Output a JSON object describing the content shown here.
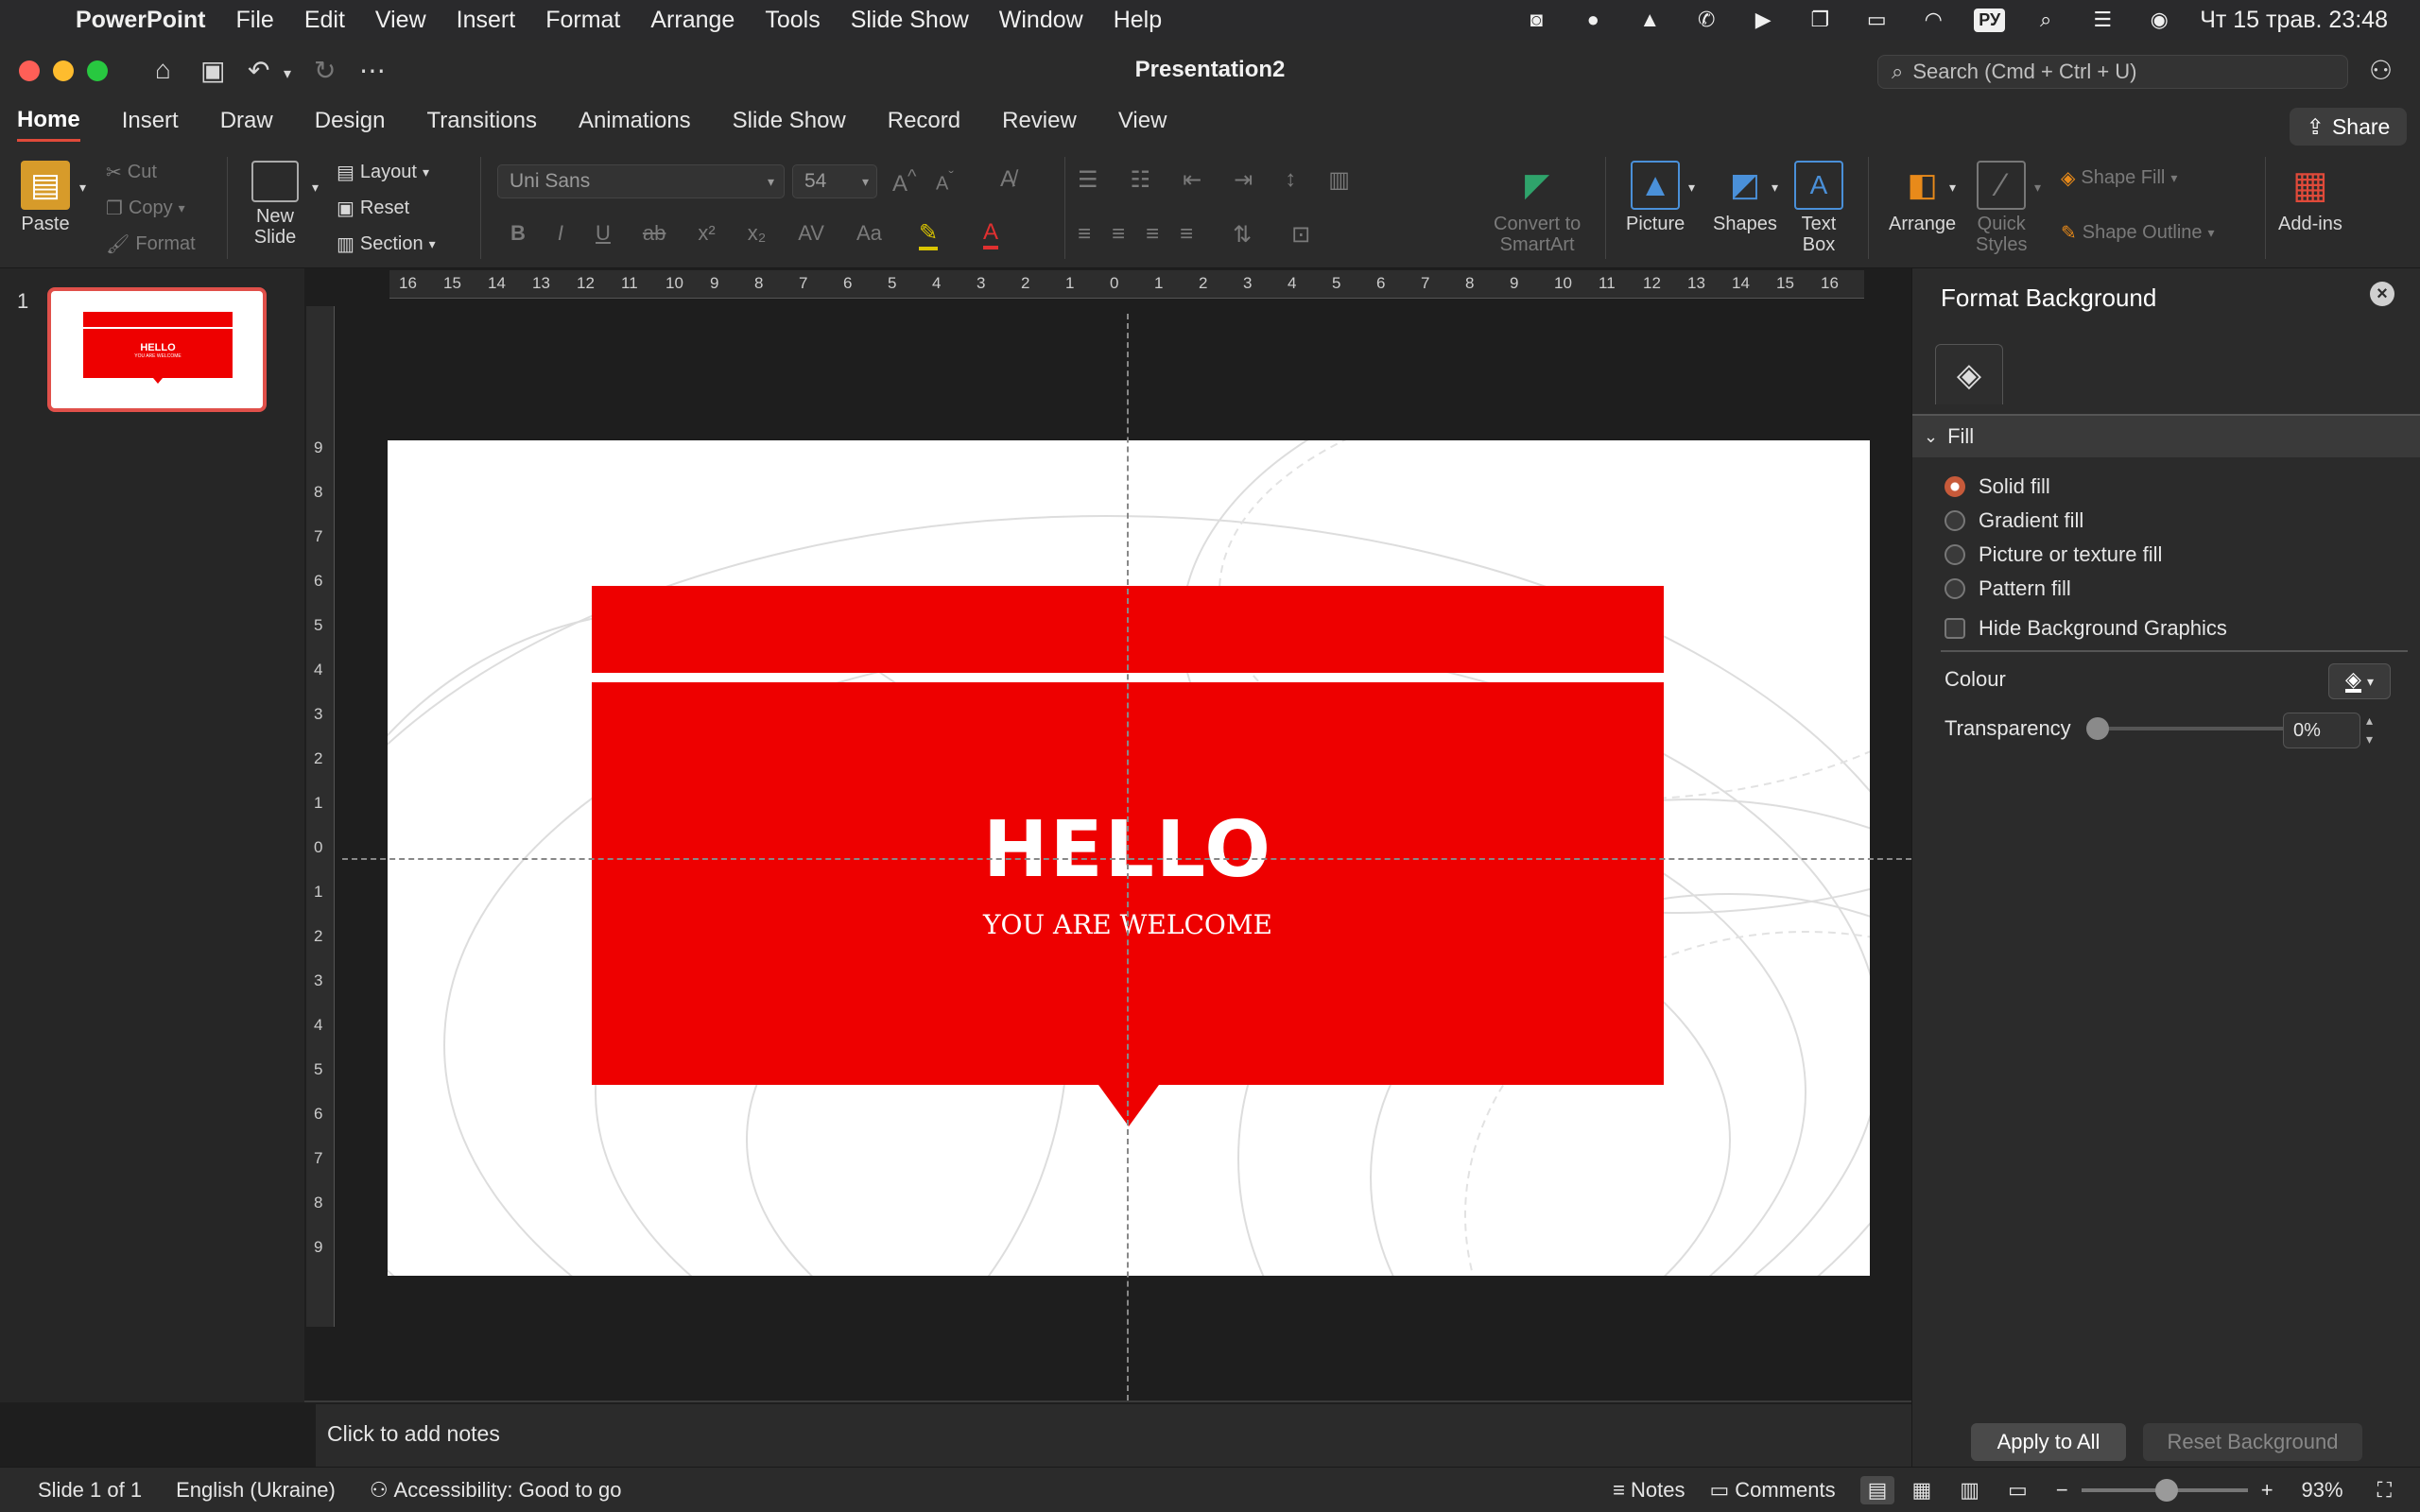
{
  "menubar": {
    "app": "PowerPoint",
    "items": [
      "File",
      "Edit",
      "View",
      "Insert",
      "Format",
      "Arrange",
      "Tools",
      "Slide Show",
      "Window",
      "Help"
    ],
    "keyboard": "РУ",
    "datetime": "Чт 15 трав.  23:48"
  },
  "window": {
    "title": "Presentation2",
    "search_placeholder": "Search (Cmd + Ctrl + U)"
  },
  "tabs": [
    "Home",
    "Insert",
    "Draw",
    "Design",
    "Transitions",
    "Animations",
    "Slide Show",
    "Record",
    "Review",
    "View"
  ],
  "share_label": "Share",
  "ribbon": {
    "paste": "Paste",
    "cut": "Cut",
    "copy": "Copy",
    "format": "Format",
    "new_slide": "New\nSlide",
    "layout": "Layout",
    "reset": "Reset",
    "section": "Section",
    "font_name": "Uni Sans",
    "font_size": "54",
    "convert_smartart": "Convert to\nSmartArt",
    "picture": "Picture",
    "shapes": "Shapes",
    "text_box": "Text\nBox",
    "arrange": "Arrange",
    "quick_styles": "Quick\nStyles",
    "shape_fill": "Shape Fill",
    "shape_outline": "Shape Outline",
    "addins": "Add-ins"
  },
  "thumbnails": {
    "number": "1",
    "title": "HELLO",
    "subtitle": "YOU ARE WELCOME"
  },
  "slide": {
    "title": "HELLO",
    "subtitle": "YOU ARE WELCOME",
    "accent_color": "#ee0000"
  },
  "rulers": {
    "top": [
      "16",
      "15",
      "14",
      "13",
      "12",
      "11",
      "10",
      "9",
      "8",
      "7",
      "6",
      "5",
      "4",
      "3",
      "2",
      "1",
      "0",
      "1",
      "2",
      "3",
      "4",
      "5",
      "6",
      "7",
      "8",
      "9",
      "10",
      "11",
      "12",
      "13",
      "14",
      "15",
      "16"
    ],
    "left": [
      "9",
      "8",
      "7",
      "6",
      "5",
      "4",
      "3",
      "2",
      "1",
      "0",
      "1",
      "2",
      "3",
      "4",
      "5",
      "6",
      "7",
      "8",
      "9"
    ]
  },
  "notes_placeholder": "Click to add notes",
  "format_background": {
    "title": "Format Background",
    "section": "Fill",
    "options": [
      "Solid fill",
      "Gradient fill",
      "Picture or texture fill",
      "Pattern fill"
    ],
    "selected": "Solid fill",
    "hide_graphics": "Hide Background Graphics",
    "colour_label": "Colour",
    "transparency_label": "Transparency",
    "transparency_value": "0%",
    "apply_all": "Apply to All",
    "reset_background": "Reset Background"
  },
  "status": {
    "slide_of": "Slide 1 of 1",
    "language": "English (Ukraine)",
    "accessibility": "Accessibility: Good to go",
    "notes": "Notes",
    "comments": "Comments",
    "zoom": "93%"
  }
}
